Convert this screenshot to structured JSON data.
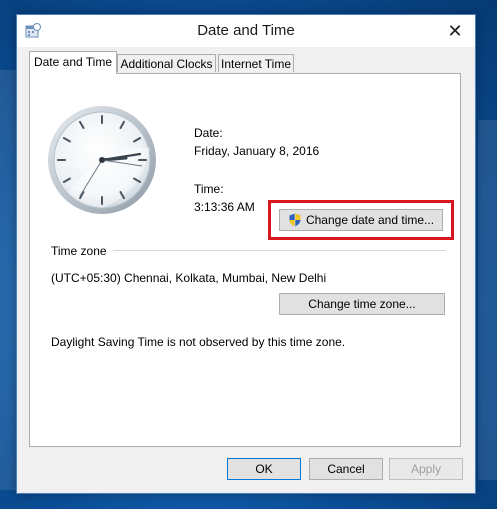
{
  "window": {
    "title": "Date and Time",
    "close_glyph": "✕"
  },
  "tabs": [
    {
      "label": "Date and Time",
      "active": true
    },
    {
      "label": "Additional Clocks",
      "active": false
    },
    {
      "label": "Internet Time",
      "active": false
    }
  ],
  "date_time": {
    "date_label": "Date:",
    "date_value": "Friday, January 8, 2016",
    "time_label": "Time:",
    "time_value": "3:13:36 AM",
    "change_button": "Change date and time..."
  },
  "time_zone": {
    "section_label": "Time zone",
    "value": "(UTC+05:30) Chennai, Kolkata, Mumbai, New Delhi",
    "change_button": "Change time zone..."
  },
  "dst_note": "Daylight Saving Time is not observed by this time zone.",
  "footer": {
    "ok": "OK",
    "cancel": "Cancel",
    "apply": "Apply"
  },
  "colors": {
    "highlight": "#d9161e",
    "accent": "#0078d7"
  }
}
